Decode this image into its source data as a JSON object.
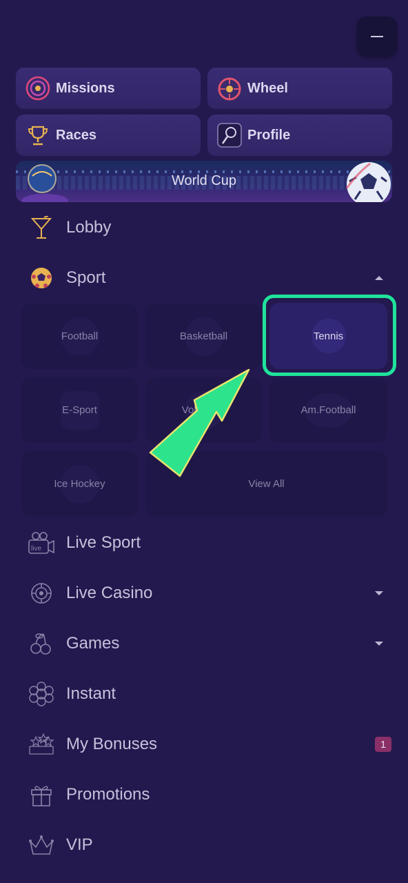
{
  "quick_links": [
    {
      "label": "Missions",
      "icon": "target-icon"
    },
    {
      "label": "Wheel",
      "icon": "fortune-wheel-icon"
    },
    {
      "label": "Races",
      "icon": "trophy-icon"
    },
    {
      "label": "Profile",
      "icon": "profile-icon"
    }
  ],
  "banner": {
    "label": "World Cup"
  },
  "menu": {
    "lobby": "Lobby",
    "sport": "Sport",
    "live_sport": "Live Sport",
    "live_casino": "Live Casino",
    "games": "Games",
    "instant": "Instant",
    "my_bonuses": "My Bonuses",
    "my_bonuses_badge": "1",
    "promotions": "Promotions",
    "vip": "VIP"
  },
  "sports": {
    "football": "Football",
    "basketball": "Basketball",
    "tennis": "Tennis",
    "esport": "E-Sport",
    "volleyball": "Volleyball",
    "am_football": "Am.Football",
    "ice_hockey": "Ice Hockey",
    "view_all": "View All"
  },
  "colors": {
    "background": "#24194e",
    "highlight": "#1fe39a",
    "arrow": "#2de38c",
    "badge": "#8a2f68"
  }
}
